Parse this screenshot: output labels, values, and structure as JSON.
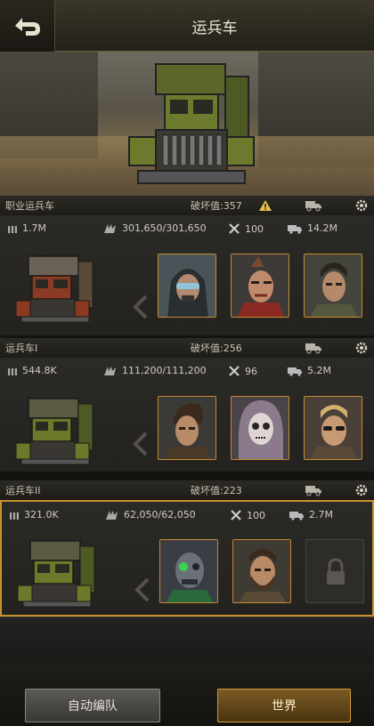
{
  "header": {
    "title": "运兵车"
  },
  "squads": [
    {
      "name": "职业运兵车",
      "power": "破坏值:357",
      "stats": {
        "ammo": "1.7M",
        "hp": "301,650/301,650",
        "repair": "100",
        "load": "14.2M"
      },
      "truck_color": "#8a3a22",
      "heroes": [
        "hero-gasmask",
        "hero-punk",
        "hero-soldier"
      ]
    },
    {
      "name": "运兵车I",
      "power": "破坏值:256",
      "stats": {
        "ammo": "544.8K",
        "hp": "111,200/111,200",
        "repair": "96",
        "load": "5.2M"
      },
      "truck_color": "#6a7a2a",
      "heroes": [
        "hero-rugged",
        "hero-skull-mask",
        "hero-sunglasses"
      ]
    },
    {
      "name": "运兵车II",
      "power": "破坏值:223",
      "stats": {
        "ammo": "321.0K",
        "hp": "62,050/62,050",
        "repair": "100",
        "load": "2.7M"
      },
      "truck_color": "#6a7a2a",
      "heroes": [
        "hero-cyborg",
        "hero-bearded",
        "locked-slot"
      ]
    }
  ],
  "footer": {
    "auto_label": "自动编队",
    "world_label": "世界"
  },
  "colors": {
    "accent": "#c8922e",
    "panel": "#2b2a27"
  }
}
